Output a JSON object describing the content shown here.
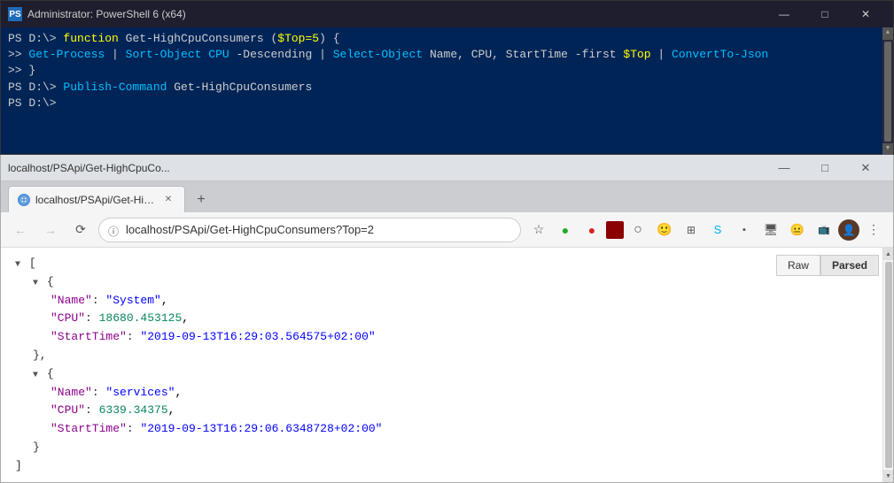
{
  "powershell": {
    "title": "Administrator: PowerShell 6 (x64)",
    "lines": [
      {
        "parts": [
          {
            "text": "PS D:\\> ",
            "color": "white"
          },
          {
            "text": "function",
            "color": "yellow"
          },
          {
            "text": " Get-HighCpuConsumers (",
            "color": "white"
          },
          {
            "text": "$Top=5",
            "color": "yellow"
          },
          {
            "text": ") {",
            "color": "white"
          }
        ]
      },
      {
        "parts": [
          {
            "text": ">> ",
            "color": "white"
          },
          {
            "text": "    Get-Process",
            "color": "cyan"
          },
          {
            "text": " | ",
            "color": "white"
          },
          {
            "text": "Sort-Object",
            "color": "cyan"
          },
          {
            "text": " CPU -Descending | ",
            "color": "white"
          },
          {
            "text": "Select-Object",
            "color": "cyan"
          },
          {
            "text": " Name, CPU, StartTime -first ",
            "color": "white"
          },
          {
            "text": "$Top",
            "color": "yellow"
          },
          {
            "text": " | ",
            "color": "white"
          },
          {
            "text": "ConvertTo-Json",
            "color": "cyan"
          }
        ]
      },
      {
        "parts": [
          {
            "text": ">> }",
            "color": "white"
          }
        ]
      },
      {
        "parts": [
          {
            "text": "PS D:\\> ",
            "color": "white"
          },
          {
            "text": "Publish-Command",
            "color": "cyan"
          },
          {
            "text": " Get-HighCpuConsumers",
            "color": "white"
          }
        ]
      },
      {
        "parts": [
          {
            "text": "PS D:\\>",
            "color": "white"
          }
        ]
      }
    ]
  },
  "browser": {
    "title": "localhost/PSApi/Get-HighCpuCo...",
    "tab_label": "localhost/PSApi/Get-HighCpuCo...",
    "address": "localhost/PSApi/Get-HighCpuConsumers?Top=2",
    "raw_btn": "Raw",
    "parsed_btn": "Parsed",
    "json_content": {
      "array_open": "[",
      "array_close": "]",
      "items": [
        {
          "name_key": "\"Name\"",
          "name_val": "\"System\"",
          "cpu_key": "\"CPU\"",
          "cpu_val": "18680.453125",
          "time_key": "\"StartTime\"",
          "time_val": "\"2019-09-13T16:29:03.564575+02:00\""
        },
        {
          "name_key": "\"Name\"",
          "name_val": "\"services\"",
          "cpu_key": "\"CPU\"",
          "cpu_val": "6339.34375",
          "time_key": "\"StartTime\"",
          "time_val": "\"2019-09-13T16:29:06.6348728+02:00\""
        }
      ]
    }
  }
}
